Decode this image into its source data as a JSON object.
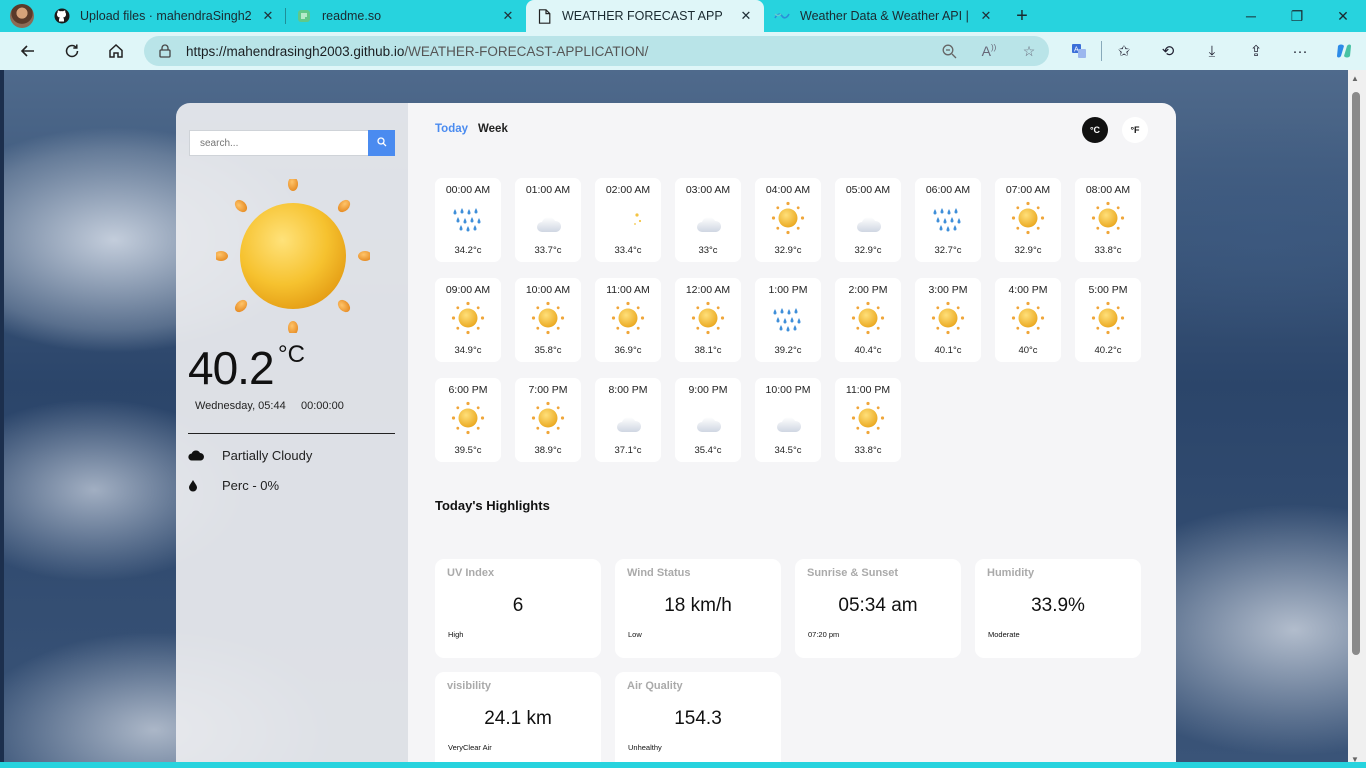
{
  "browser": {
    "tabs": [
      {
        "title": "Upload files · mahendraSingh200",
        "icon": "github-icon"
      },
      {
        "title": "readme.so",
        "icon": "readme-icon"
      },
      {
        "title": "WEATHER FORECAST APP",
        "icon": "page-icon"
      },
      {
        "title": "Weather Data & Weather API | Vi",
        "icon": "visualcrossing-icon"
      }
    ],
    "url_host": "https://mahendrasingh2003.github.io",
    "url_path": "/WEATHER-FORECAST-APPLICATION/"
  },
  "sidebar": {
    "search_placeholder": "search...",
    "temperature": "40.2",
    "unit": "°C",
    "datetime": "Wednesday, 05:44     00:00:00",
    "condition": "Partially Cloudy",
    "precip": "Perc - 0%"
  },
  "main": {
    "tab_today": "Today",
    "tab_week": "Week",
    "unit_c": "°C",
    "unit_f": "°F",
    "hours": [
      {
        "time": "00:00 AM",
        "icon": "rain",
        "temp": "34.2°c"
      },
      {
        "time": "01:00 AM",
        "icon": "moon-cloud",
        "temp": "33.7°c"
      },
      {
        "time": "02:00 AM",
        "icon": "moon",
        "temp": "33.4°c"
      },
      {
        "time": "03:00 AM",
        "icon": "moon-cloud",
        "temp": "33°c"
      },
      {
        "time": "04:00 AM",
        "icon": "sun",
        "temp": "32.9°c"
      },
      {
        "time": "05:00 AM",
        "icon": "moon-cloud",
        "temp": "32.9°c"
      },
      {
        "time": "06:00 AM",
        "icon": "rain",
        "temp": "32.7°c"
      },
      {
        "time": "07:00 AM",
        "icon": "sun",
        "temp": "32.9°c"
      },
      {
        "time": "08:00 AM",
        "icon": "sun",
        "temp": "33.8°c"
      },
      {
        "time": "09:00 AM",
        "icon": "sun",
        "temp": "34.9°c"
      },
      {
        "time": "10:00 AM",
        "icon": "sun",
        "temp": "35.8°c"
      },
      {
        "time": "11:00 AM",
        "icon": "sun",
        "temp": "36.9°c"
      },
      {
        "time": "12:00 AM",
        "icon": "sun",
        "temp": "38.1°c"
      },
      {
        "time": "1:00 PM",
        "icon": "rain",
        "temp": "39.2°c"
      },
      {
        "time": "2:00 PM",
        "icon": "sun",
        "temp": "40.4°c"
      },
      {
        "time": "3:00 PM",
        "icon": "sun",
        "temp": "40.1°c"
      },
      {
        "time": "4:00 PM",
        "icon": "sun",
        "temp": "40°c"
      },
      {
        "time": "5:00 PM",
        "icon": "sun",
        "temp": "40.2°c"
      },
      {
        "time": "6:00 PM",
        "icon": "sun",
        "temp": "39.5°c"
      },
      {
        "time": "7:00 PM",
        "icon": "sun",
        "temp": "38.9°c"
      },
      {
        "time": "8:00 PM",
        "icon": "moon-cloud",
        "temp": "37.1°c"
      },
      {
        "time": "9:00 PM",
        "icon": "moon-cloud",
        "temp": "35.4°c"
      },
      {
        "time": "10:00 PM",
        "icon": "moon-cloud",
        "temp": "34.5°c"
      },
      {
        "time": "11:00 PM",
        "icon": "sun",
        "temp": "33.8°c"
      }
    ],
    "highlights_title": "Today's Highlights",
    "highlights": [
      {
        "label": "UV Index",
        "value": "6",
        "sub": "High"
      },
      {
        "label": "Wind Status",
        "value": "18 km/h",
        "sub": "Low"
      },
      {
        "label": "Sunrise & Sunset",
        "value": "05:34 am",
        "sub": "07:20 pm"
      },
      {
        "label": "Humidity",
        "value": "33.9%",
        "sub": "Moderate"
      },
      {
        "label": "visibility",
        "value": "24.1 km",
        "sub": "VeryClear Air"
      },
      {
        "label": "Air Quality",
        "value": "154.3",
        "sub": "Unhealthy"
      }
    ]
  }
}
